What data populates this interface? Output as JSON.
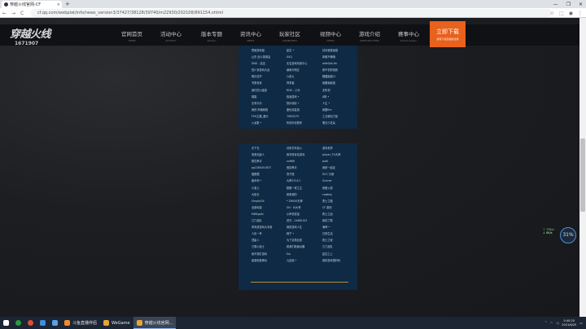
{
  "browser": {
    "tab_title": "穿越火线官网-CF",
    "tab_close": "×",
    "new_tab": "+",
    "url": "cf.qq.com/webplat/info/news_version3/37427/38128/39740/m22930/202108/891154.shtml",
    "nav_back": "←",
    "nav_forward": "→",
    "nav_reload": "C",
    "window_controls": [
      "—",
      "❐",
      "✕"
    ]
  },
  "site": {
    "logo_title": "穿越火线",
    "logo_number": "1671907",
    "nav": [
      {
        "label": "官网首页",
        "en": "HOME"
      },
      {
        "label": "活动中心",
        "en": "ACTIVITY"
      },
      {
        "label": "版本专题",
        "en": "Version"
      },
      {
        "label": "资讯中心",
        "en": "NEWS"
      },
      {
        "label": "玩家社区",
        "en": "COMMUNITY"
      },
      {
        "label": "视频中心",
        "en": "VIDEO"
      },
      {
        "label": "游戏介绍",
        "en": "INTRODUCTION"
      },
      {
        "label": "赛事中心",
        "en": "Event Center"
      }
    ],
    "download": {
      "label": "立即下载",
      "en": "游戏下载及相关支持"
    }
  },
  "list_top": [
    [
      "思维游戏组",
      "山东·战斗英雄会",
      "DNG - 高洁",
      "四川省游戏大会",
      "明月佳节",
      "书香世家",
      "我们的小迷宫",
      "喵喵",
      "无事乐乐",
      "我的·风格网络",
      "FEH主播_爱乐",
      "火龙数 •"
    ],
    [
      "星空 •",
      "XXQ",
      "无名游戏玩家中心",
      "暴雨分明正",
      "六叔九",
      "同事客",
      "RDG - 小乐",
      "极速游戏 •",
      "快乐精彩 •",
      "爱玩双星游",
      "799GG79",
      "听说你也想来"
    ],
    [
      "请问我是最强",
      "床都不懂哦",
      "wifeGok.fm",
      "我不怕你找我",
      "骚骚姐姐11",
      "我要我最强",
      "无所谓",
      "A狗 •",
      "人生 •",
      "我要fire",
      "工业驱动力量",
      "明日小花朵"
    ]
  ],
  "list_bottom": [
    [
      "天下无",
      "电竞无敌人",
      "属性拳手",
      "qq2280451637",
      "做数据",
      "魔术师 •",
      "小宝儿",
      "大班长",
      "SimpleCN",
      "全部电量",
      "MMKgold",
      "江门战队",
      "黄鸡进游戏大本营",
      "人民一号",
      "顶星人",
      "江阴小战士",
      "我不想打游戏",
      "最强电竞神兵"
    ],
    [
      "请来打你战斗",
      "我非常喜欢游戏",
      "xx666",
      "竞技拳手",
      "双子座",
      "大神1314人",
      "数据一家之主",
      "看看我的",
      "* ZH000天神",
      "GH · XI大哥",
      "小声说说话",
      "虎牙 - 24681021",
      "我的游戏人生",
      "网子 •",
      "为了这场比赛",
      "看我们新版兵器",
      "Elo",
      "九连冠 •"
    ],
    [
      "游戏世界",
      "player_TH大神",
      "pzzk",
      "我家一起走",
      "DCC 分部",
      "Gunner",
      "我爱火线",
      "cowboy",
      "勇士之路",
      "CF 原则",
      "勇士之战",
      "我说了算",
      "海神 •",
      "日常生活",
      "勇士之家",
      "江门战队",
      "星空之上",
      "我的游戏很好玩"
    ]
  ],
  "widget": {
    "up": "↑ 79K/s",
    "down": "↓ 0K/s",
    "percent": "31%"
  },
  "taskbar": {
    "items": [
      "斗鱼直播伴侣",
      "WeGame",
      "穿越火线官网..."
    ],
    "time": "0:40:20",
    "date": "2021/6/25"
  },
  "colors": {
    "accent": "#e8611d",
    "panel": "#0f2a44",
    "gold_line": "#b98a3c"
  }
}
